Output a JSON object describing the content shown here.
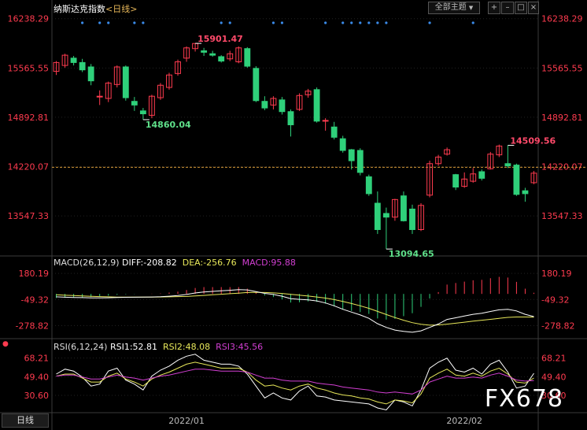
{
  "header": {
    "title": "纳斯达克指数",
    "period": "<日线>",
    "dropdown_label": "全部主题",
    "dropdown_arrow": "▼",
    "icons": [
      "add-icon",
      "minimize-icon",
      "restore-icon",
      "close-icon"
    ]
  },
  "macd_header": {
    "params": "MACD(26,12,9)",
    "diff": "DIFF:-208.82",
    "dea": "DEA:-256.76",
    "macd": "MACD:95.88"
  },
  "rsi_header": {
    "params": "RSI(6,12,24)",
    "rsi1": "RSI1:52.81",
    "rsi2": "RSI2:48.08",
    "rsi3": "RSI3:45.56"
  },
  "footer": {
    "tab_label": "日线",
    "x_labels": [
      "2022/01",
      "2022/02"
    ]
  },
  "watermark": "FX678",
  "colors": {
    "up": "#ff3b4f",
    "down": "#2fd07a",
    "diff_line": "#ffffff",
    "dea_line": "#e8e85a",
    "macd_label": "#d23fd2",
    "rsi3_line": "#d23fd2",
    "grid": "#3a3a3a",
    "current_price_line": "#d99b3a"
  },
  "chart_data": [
    {
      "type": "candlestick",
      "title": "纳斯达克指数 <日线>",
      "y_ticks": [
        "16238.29",
        "15565.55",
        "14892.81",
        "14220.07",
        "13547.33"
      ],
      "ylim": [
        13000,
        16300
      ],
      "current_price_line": 14210,
      "annotations": [
        {
          "label": "15901.47",
          "kind": "high"
        },
        {
          "label": "14860.04",
          "kind": "low"
        },
        {
          "label": "14509.56",
          "kind": "high"
        },
        {
          "label": "13094.65",
          "kind": "low"
        }
      ],
      "candles": [
        [
          15520,
          15640,
          15470,
          15660
        ],
        [
          15600,
          15740,
          15570,
          15760
        ],
        [
          15700,
          15640,
          15600,
          15730
        ],
        [
          15640,
          15540,
          15510,
          15690
        ],
        [
          15580,
          15390,
          15330,
          15620
        ],
        [
          15170,
          15180,
          15060,
          15260
        ],
        [
          15150,
          15360,
          15100,
          15380
        ],
        [
          15340,
          15580,
          15300,
          15600
        ],
        [
          15580,
          15160,
          15120,
          15600
        ],
        [
          15110,
          15060,
          14980,
          15170
        ],
        [
          14980,
          14940,
          14860,
          15020
        ],
        [
          14920,
          15180,
          14880,
          15200
        ],
        [
          15160,
          15330,
          15130,
          15360
        ],
        [
          15300,
          15470,
          15270,
          15500
        ],
        [
          15490,
          15650,
          15460,
          15680
        ],
        [
          15700,
          15840,
          15650,
          15860
        ],
        [
          15830,
          15900,
          15790,
          15901.47
        ],
        [
          15800,
          15780,
          15730,
          15840
        ],
        [
          15760,
          15740,
          15720,
          15800
        ],
        [
          15720,
          15660,
          15640,
          15740
        ],
        [
          15690,
          15760,
          15660,
          15800
        ],
        [
          15650,
          15840,
          15630,
          15860
        ],
        [
          15830,
          15590,
          15570,
          15850
        ],
        [
          15560,
          15120,
          15100,
          15590
        ],
        [
          15110,
          15020,
          14990,
          15180
        ],
        [
          15060,
          15150,
          15000,
          15180
        ],
        [
          15130,
          14970,
          14930,
          15170
        ],
        [
          14970,
          14790,
          14630,
          15000
        ],
        [
          15000,
          15190,
          14980,
          15220
        ],
        [
          15200,
          15250,
          15160,
          15280
        ],
        [
          15270,
          14840,
          14820,
          15300
        ],
        [
          14840,
          14850,
          14710,
          14880
        ],
        [
          14760,
          14620,
          14590,
          14830
        ],
        [
          14600,
          14440,
          14410,
          14640
        ],
        [
          14450,
          14300,
          14180,
          14460
        ],
        [
          14440,
          14140,
          14100,
          14470
        ],
        [
          14080,
          13850,
          13820,
          14110
        ],
        [
          13720,
          13360,
          13300,
          13880
        ],
        [
          13580,
          13530,
          13094.65,
          13660
        ],
        [
          13530,
          13770,
          13480,
          13780
        ],
        [
          13820,
          13480,
          13470,
          13880
        ],
        [
          13640,
          13360,
          13300,
          13700
        ],
        [
          13360,
          13690,
          13340,
          13720
        ],
        [
          13830,
          14260,
          13800,
          14300
        ],
        [
          14260,
          14350,
          14230,
          14380
        ],
        [
          14390,
          14450,
          14370,
          14480
        ],
        [
          14110,
          13940,
          13900,
          14120
        ],
        [
          13950,
          14050,
          13930,
          14140
        ],
        [
          14020,
          14120,
          14000,
          14200
        ],
        [
          14150,
          14060,
          14030,
          14180
        ],
        [
          14190,
          14390,
          14180,
          14420
        ],
        [
          14380,
          14500,
          14350,
          14520
        ],
        [
          14260,
          14230,
          14200,
          14509.56
        ],
        [
          14240,
          13840,
          13820,
          14260
        ],
        [
          13890,
          13850,
          13740,
          13930
        ],
        [
          14000,
          14130,
          13980,
          14160
        ]
      ]
    },
    {
      "type": "bar+line",
      "title": "MACD(26,12,9)",
      "y_ticks": [
        "180.19",
        "-49.32",
        "-278.82"
      ],
      "ylim": [
        -380,
        230
      ],
      "series": [
        {
          "name": "DIFF",
          "values": [
            -26,
            -29,
            -31,
            -33,
            -35,
            -35,
            -34,
            -32,
            -30,
            -29,
            -28,
            -27,
            -25,
            -20,
            -14,
            -5,
            8,
            17,
            22,
            27,
            32,
            37,
            35,
            20,
            5,
            -5,
            -20,
            -42,
            -48,
            -52,
            -62,
            -80,
            -105,
            -135,
            -160,
            -185,
            -215,
            -262,
            -295,
            -318,
            -330,
            -338,
            -325,
            -295,
            -265,
            -225,
            -210,
            -195,
            -180,
            -170,
            -155,
            -140,
            -135,
            -150,
            -180,
            -200
          ]
        },
        {
          "name": "DEA",
          "values": [
            -8,
            -12,
            -15,
            -18,
            -21,
            -24,
            -26,
            -28,
            -28,
            -28,
            -28,
            -28,
            -27,
            -26,
            -24,
            -22,
            -18,
            -13,
            -8,
            -3,
            2,
            7,
            12,
            13,
            12,
            9,
            4,
            -4,
            -11,
            -19,
            -27,
            -37,
            -50,
            -67,
            -85,
            -105,
            -127,
            -154,
            -182,
            -208,
            -232,
            -253,
            -268,
            -275,
            -273,
            -266,
            -258,
            -249,
            -240,
            -232,
            -224,
            -215,
            -207,
            -203,
            -203,
            -205
          ]
        },
        {
          "name": "MACD",
          "values": [
            -36,
            -34,
            -32,
            -30,
            -28,
            -22,
            -16,
            -8,
            -4,
            -2,
            0,
            2,
            4,
            12,
            20,
            34,
            52,
            60,
            60,
            60,
            60,
            60,
            46,
            14,
            -14,
            -28,
            -48,
            -76,
            -74,
            -66,
            -70,
            -86,
            -110,
            -136,
            -150,
            -160,
            -176,
            -216,
            -226,
            -220,
            -196,
            -170,
            -114,
            -40,
            16,
            82,
            96,
            108,
            120,
            124,
            138,
            150,
            144,
            106,
            46,
            10
          ]
        }
      ]
    },
    {
      "type": "line",
      "title": "RSI(6,12,24)",
      "y_ticks": [
        "68.21",
        "49.40",
        "30.60"
      ],
      "ylim": [
        14,
        75
      ],
      "series": [
        {
          "name": "RSI1",
          "values": [
            52,
            57,
            55,
            49,
            40,
            42,
            55,
            58,
            46,
            42,
            36,
            50,
            56,
            60,
            66,
            70,
            72,
            66,
            64,
            62,
            62,
            60,
            52,
            40,
            28,
            33,
            28,
            26,
            35,
            40,
            30,
            29,
            26,
            25,
            24,
            23,
            22,
            18,
            16,
            26,
            24,
            20,
            36,
            58,
            64,
            68,
            56,
            54,
            58,
            52,
            62,
            66,
            54,
            38,
            40,
            52.81
          ]
        },
        {
          "name": "RSI2",
          "values": [
            50,
            52,
            52,
            48,
            44,
            44,
            50,
            53,
            47,
            44,
            40,
            47,
            51,
            54,
            58,
            62,
            64,
            62,
            60,
            58,
            58,
            58,
            54,
            46,
            40,
            41,
            38,
            36,
            40,
            42,
            38,
            36,
            33,
            31,
            30,
            28,
            27,
            24,
            22,
            26,
            25,
            23,
            32,
            48,
            53,
            57,
            51,
            50,
            53,
            50,
            55,
            58,
            52,
            44,
            43,
            48.08
          ]
        },
        {
          "name": "RSI3",
          "values": [
            50,
            51,
            51,
            49,
            47,
            47,
            49,
            51,
            49,
            48,
            46,
            48,
            50,
            51,
            53,
            55,
            57,
            57,
            56,
            55,
            55,
            55,
            54,
            51,
            48,
            48,
            46,
            45,
            45,
            45,
            43,
            42,
            41,
            39,
            38,
            37,
            36,
            34,
            33,
            34,
            33,
            32,
            36,
            44,
            47,
            50,
            48,
            48,
            49,
            48,
            51,
            53,
            50,
            46,
            45,
            45.56
          ]
        }
      ]
    }
  ]
}
